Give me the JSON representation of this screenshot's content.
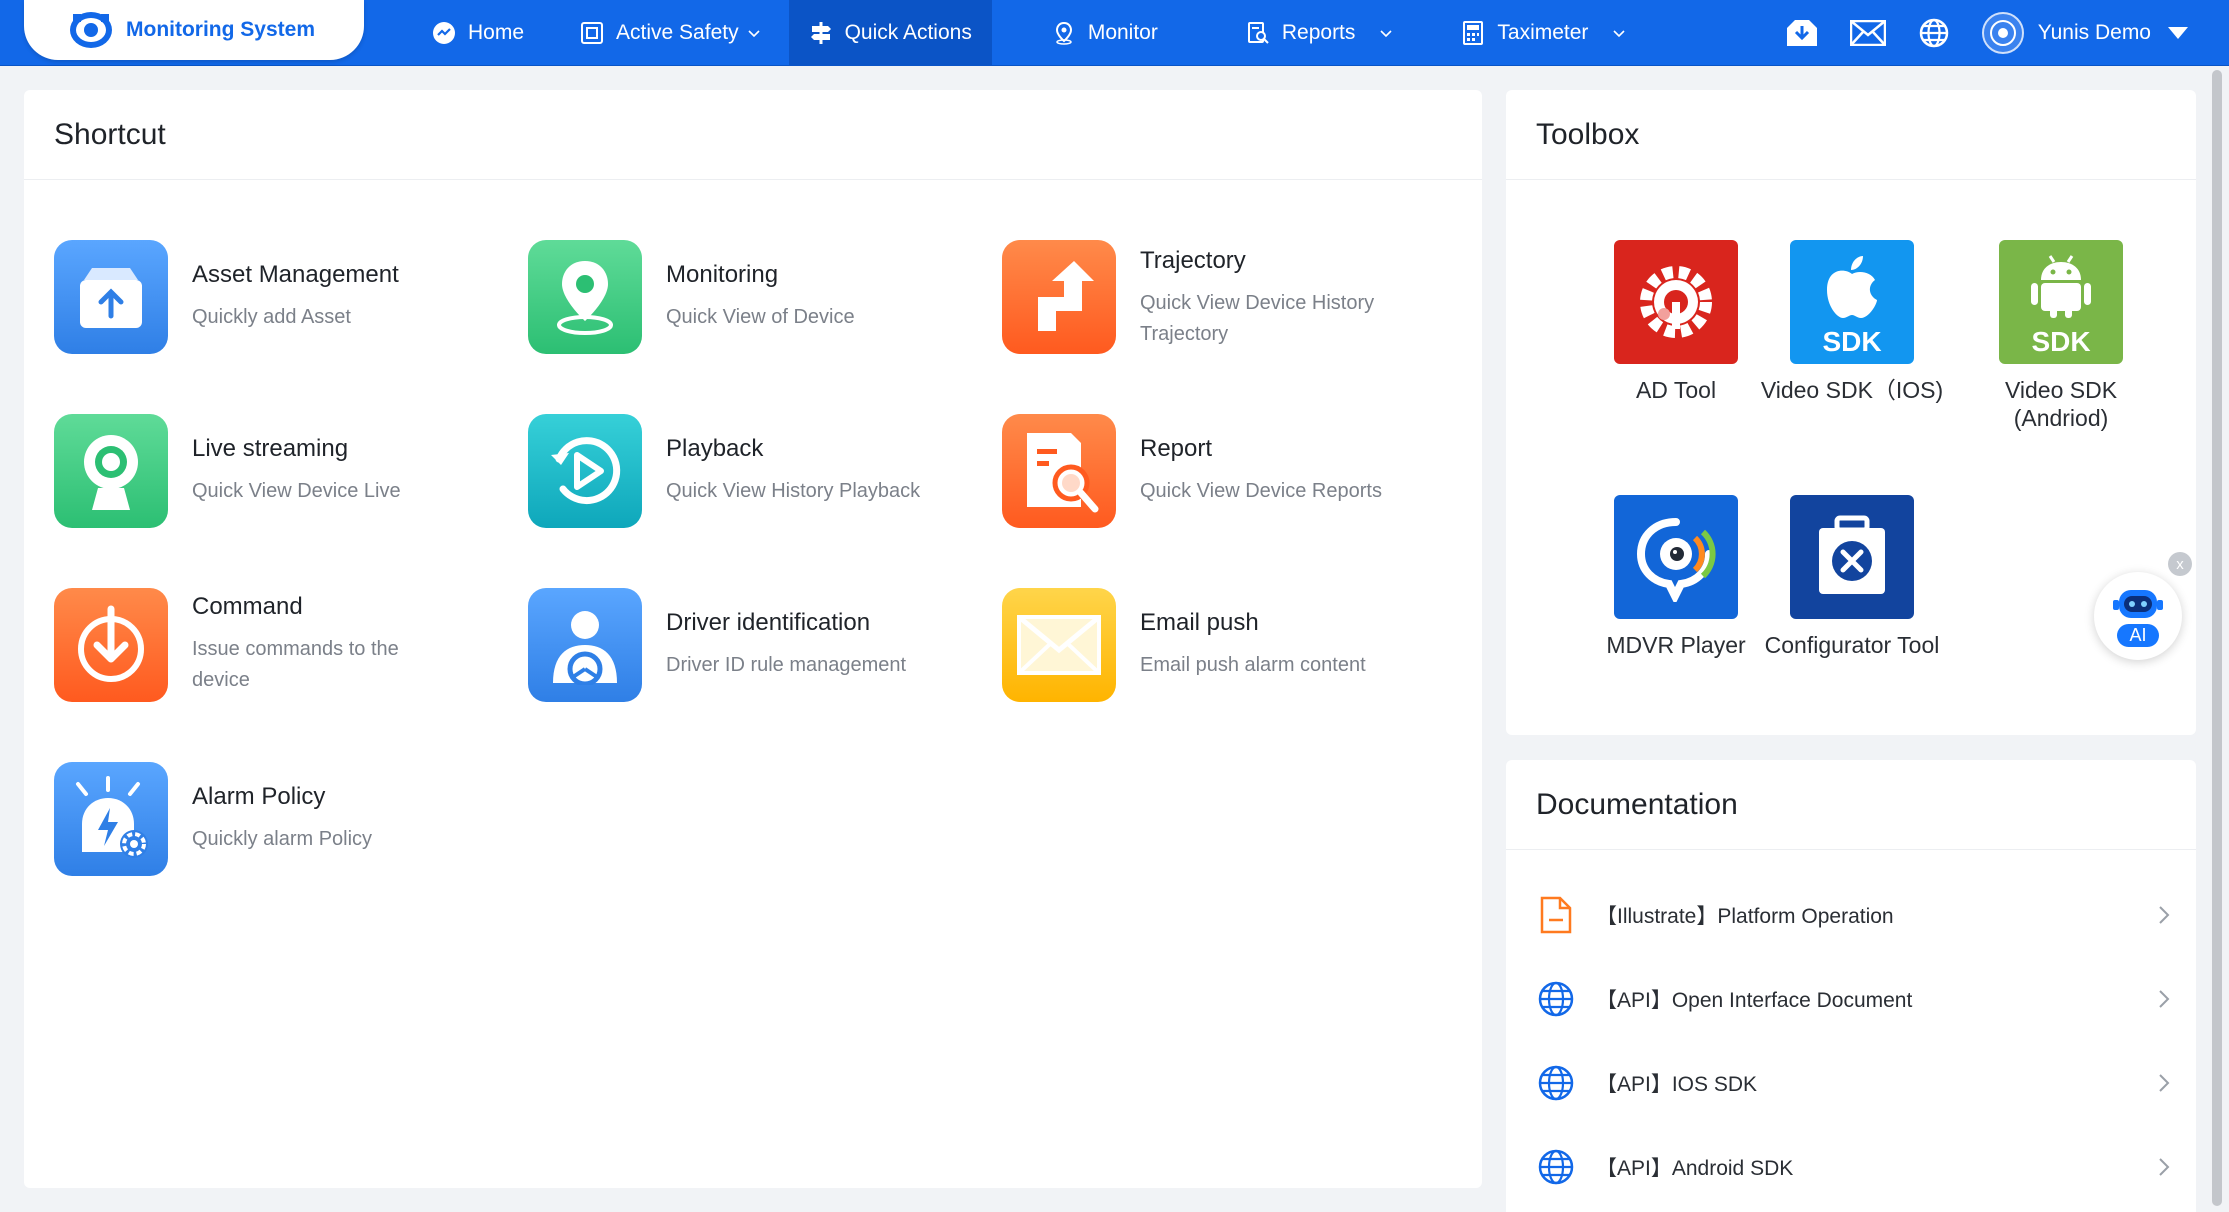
{
  "brand": {
    "name": "Monitoring System"
  },
  "nav": {
    "items": [
      {
        "label": "Home",
        "icon": "home-icon",
        "dropdown": false
      },
      {
        "label": "Active Safety",
        "icon": "active-safety-icon",
        "dropdown": true
      },
      {
        "label": "Quick Actions",
        "icon": "quick-actions-icon",
        "dropdown": false,
        "active": true
      },
      {
        "label": "Monitor",
        "icon": "monitor-pin-icon",
        "dropdown": false
      },
      {
        "label": "Reports",
        "icon": "reports-icon",
        "dropdown": true
      },
      {
        "label": "Taximeter",
        "icon": "taximeter-icon",
        "dropdown": true
      }
    ]
  },
  "user": {
    "name": "Yunis Demo"
  },
  "shortcut": {
    "title": "Shortcut",
    "items": [
      {
        "title": "Asset Management",
        "subtitle": "Quickly add Asset",
        "icon": "asset-upload-icon",
        "color": "#3b8df0"
      },
      {
        "title": "Monitoring",
        "subtitle": "Quick View of Device",
        "icon": "location-pin-icon",
        "color": "#33c77a"
      },
      {
        "title": "Trajectory",
        "subtitle": "Quick View Device History Trajectory",
        "icon": "route-arrow-icon",
        "color": "#ff6a2b"
      },
      {
        "title": "Live streaming",
        "subtitle": "Quick View Device Live",
        "icon": "webcam-icon",
        "color": "#33c77a"
      },
      {
        "title": "Playback",
        "subtitle": "Quick View History Playback",
        "icon": "playback-icon",
        "color": "#14b8c6"
      },
      {
        "title": "Report",
        "subtitle": "Quick View Device Reports",
        "icon": "report-search-icon",
        "color": "#ff6a2b"
      },
      {
        "title": "Command",
        "subtitle": "Issue commands to the device",
        "icon": "command-download-icon",
        "color": "#ff6a2b"
      },
      {
        "title": "Driver identification",
        "subtitle": "Driver ID rule management",
        "icon": "driver-icon",
        "color": "#3b8df0"
      },
      {
        "title": "Email push",
        "subtitle": "Email push alarm content",
        "icon": "email-icon",
        "color": "#ffc21a"
      },
      {
        "title": "Alarm Policy",
        "subtitle": "Quickly alarm Policy",
        "icon": "alarm-policy-icon",
        "color": "#3b8df0"
      }
    ]
  },
  "toolbox": {
    "title": "Toolbox",
    "items": [
      {
        "label": "AD Tool",
        "icon": "ad-tool-icon",
        "color": "#d9251d"
      },
      {
        "label": "Video SDK（IOS)",
        "icon": "apple-sdk-icon",
        "color": "#1296f0",
        "badge": "SDK"
      },
      {
        "label": "Video SDK (Andriod)",
        "icon": "android-sdk-icon",
        "color": "#7ab648",
        "badge": "SDK"
      },
      {
        "label": "MDVR Player",
        "icon": "mdvr-player-icon",
        "color": "#1266d8"
      },
      {
        "label": "Configurator Tool",
        "icon": "configurator-tool-icon",
        "color": "#12449e"
      }
    ]
  },
  "docs": {
    "title": "Documentation",
    "items": [
      {
        "label": "【Illustrate】Platform Operation",
        "icon": "document-icon"
      },
      {
        "label": "【API】Open Interface Document",
        "icon": "globe-icon"
      },
      {
        "label": "【API】IOS SDK",
        "icon": "globe-icon"
      },
      {
        "label": "【API】Android SDK",
        "icon": "globe-icon"
      }
    ]
  },
  "ai_widget": {
    "label": "AI",
    "close": "x"
  }
}
